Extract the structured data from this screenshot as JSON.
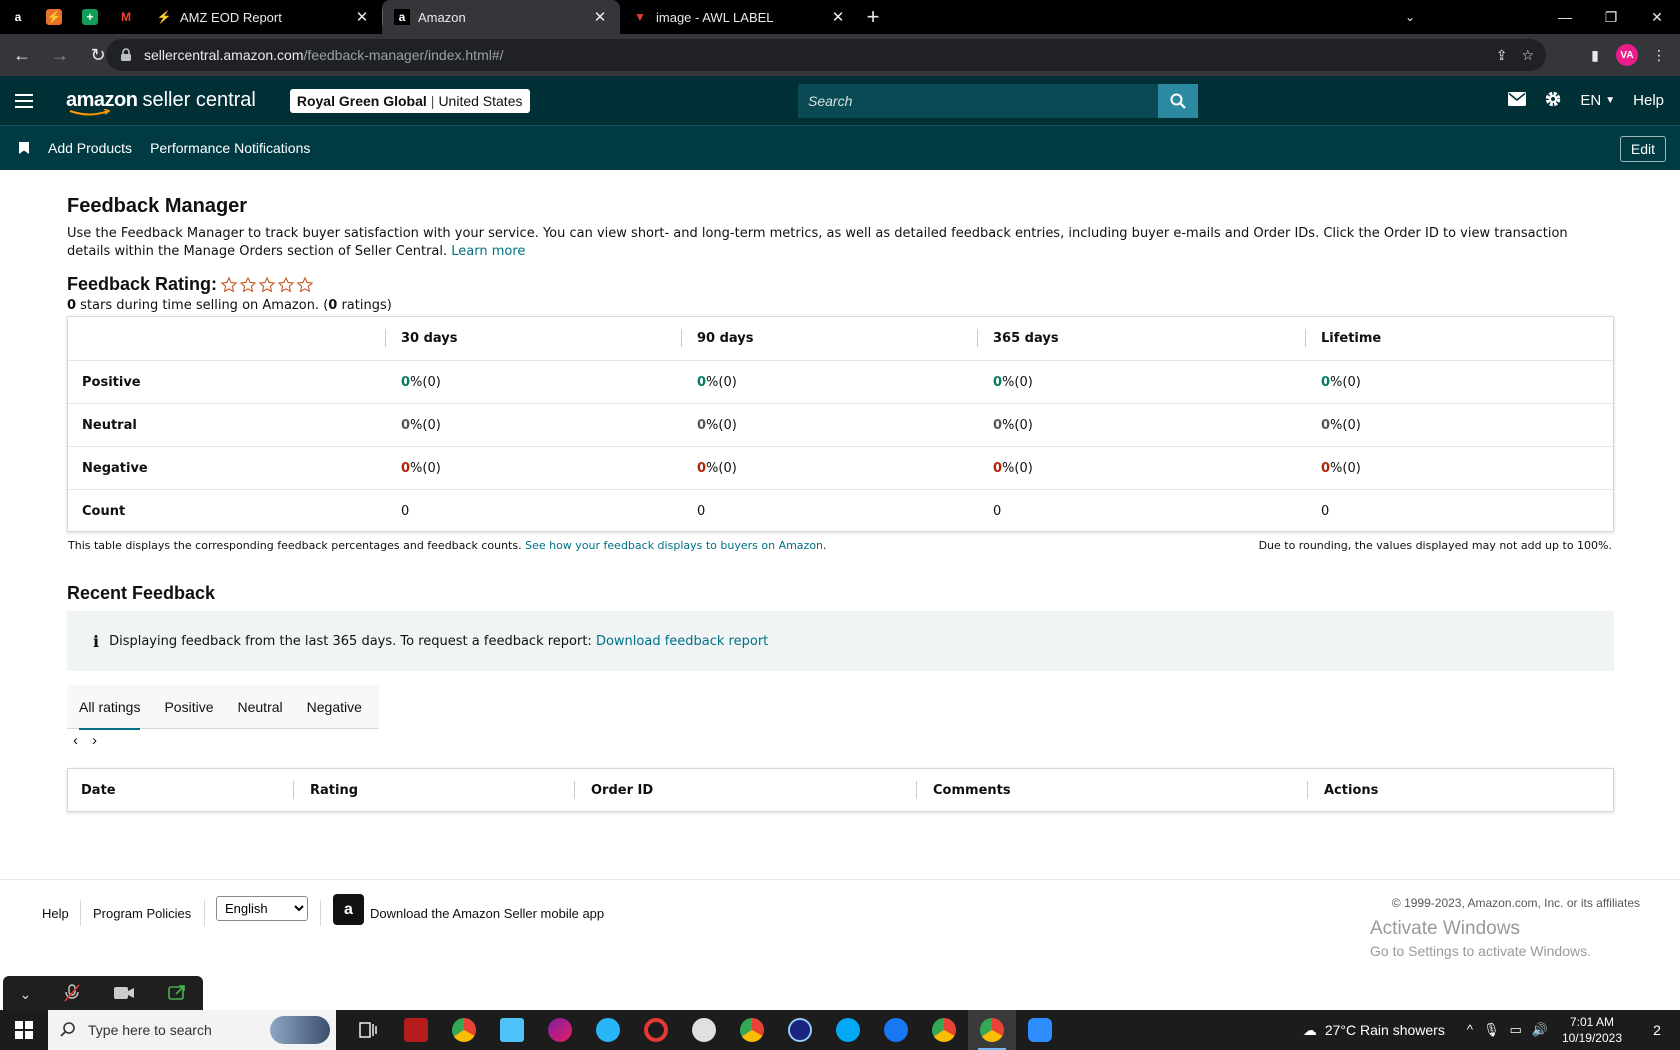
{
  "browser": {
    "tabs": [
      {
        "title": "AMZ EOD Report",
        "active": false
      },
      {
        "title": "Amazon",
        "active": true
      },
      {
        "title": "image - AWL LABEL",
        "active": false
      }
    ],
    "url_host": "sellercentral.amazon.com",
    "url_path": "/feedback-manager/index.html#/",
    "profile_initials": "VA"
  },
  "header": {
    "logo_main": "amazon",
    "logo_sub": "seller central",
    "account_name": "Royal Green Global",
    "account_sep": "|",
    "account_region": "United States",
    "search_placeholder": "Search",
    "language": "EN",
    "help": "Help"
  },
  "bookmarks": {
    "items": [
      "Add Products",
      "Performance Notifications"
    ],
    "edit": "Edit"
  },
  "page": {
    "title": "Feedback Manager",
    "intro": "Use the Feedback Manager to track buyer satisfaction with your service. You can view short- and long-term metrics, as well as detailed feedback entries, including buyer e-mails and Order IDs. Click the Order ID to view transaction details within the Manage Orders section of Seller Central.",
    "learn_more": "Learn more",
    "rating_label": "Feedback Rating:",
    "rating_stars": 0,
    "rating_stars_max": 5,
    "rating_sub": {
      "stars": "0",
      "mid": " stars during time selling on Amazon. (",
      "ratings": "0",
      "end": " ratings)"
    }
  },
  "feedback_table": {
    "columns": [
      "30 days",
      "90 days",
      "365 days",
      "Lifetime"
    ],
    "rows": [
      {
        "label": "Positive",
        "values": [
          [
            "0",
            " %(0)"
          ],
          [
            "0",
            " %(0)"
          ],
          [
            "0",
            " %(0)"
          ],
          [
            "0",
            " %(0)"
          ]
        ]
      },
      {
        "label": "Neutral",
        "values": [
          [
            "0",
            " %(0)"
          ],
          [
            "0",
            " %(0)"
          ],
          [
            "0",
            " %(0)"
          ],
          [
            "0",
            " %(0)"
          ]
        ]
      },
      {
        "label": "Negative",
        "values": [
          [
            "0",
            " %(0)"
          ],
          [
            "0",
            " %(0)"
          ],
          [
            "0",
            " %(0)"
          ],
          [
            "0",
            " %(0)"
          ]
        ]
      },
      {
        "label": "Count",
        "values": [
          "0",
          "0",
          "0",
          "0"
        ]
      }
    ],
    "note_left": "This table displays the corresponding feedback percentages and feedback counts.",
    "note_link": "See how your feedback displays to buyers on Amazon",
    "note_dot": ".",
    "note_right": "Due to rounding, the values displayed may not add up to 100%."
  },
  "recent": {
    "title": "Recent Feedback",
    "info_text": "Displaying feedback from the last 365 days. To request a feedback report:",
    "info_link": "Download feedback report",
    "tabs": [
      "All ratings",
      "Positive",
      "Neutral",
      "Negative"
    ],
    "selected_tab": "All ratings",
    "columns": [
      "Date",
      "Rating",
      "Order ID",
      "Comments",
      "Actions"
    ]
  },
  "footer": {
    "help": "Help",
    "policies": "Program Policies",
    "language": "English",
    "language_options": [
      "English"
    ],
    "app_text": "Download the Amazon Seller mobile app",
    "copyright": "© 1999-2023, Amazon.com, Inc. or its affiliates"
  },
  "windows": {
    "activate_title": "Activate Windows",
    "activate_sub": "Go to Settings to activate Windows.",
    "search_placeholder": "Type here to search",
    "weather": "27°C  Rain showers",
    "time": "7:01 AM",
    "date": "10/19/2023",
    "notifications": "2"
  },
  "colors": {
    "header_bg": "#002f36",
    "bar_bg": "#003b43",
    "link": "#007185",
    "positive": "#067d62",
    "negative": "#b12704"
  }
}
